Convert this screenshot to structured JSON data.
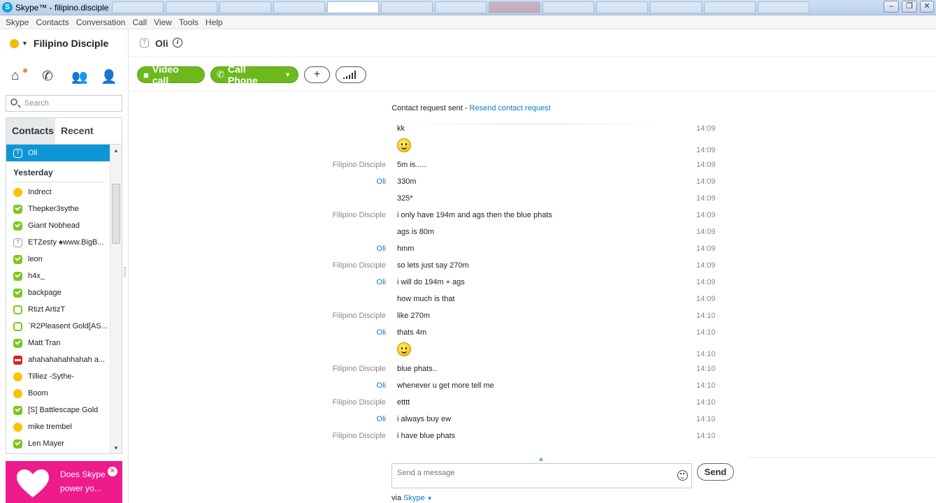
{
  "window": {
    "title": "Skype™ - filipino.disciple",
    "app_icon": "S"
  },
  "menu": [
    "Skype",
    "Contacts",
    "Conversation",
    "Call",
    "View",
    "Tools",
    "Help"
  ],
  "profile": {
    "name": "Filipino Disciple",
    "status": "away"
  },
  "search": {
    "placeholder": "Search"
  },
  "tabs": {
    "contacts": "Contacts",
    "recent": "Recent"
  },
  "contacts": {
    "selected": {
      "name": "Oli",
      "status": "unknown"
    },
    "group_label": "Yesterday",
    "items": [
      {
        "name": "Indrect",
        "status": "away"
      },
      {
        "name": "Thepker3sythe",
        "status": "online"
      },
      {
        "name": "Giant Nobhead",
        "status": "online"
      },
      {
        "name": "ETZesty ♠www.BigB...",
        "status": "unknown"
      },
      {
        "name": "leon",
        "status": "online"
      },
      {
        "name": "h4x_",
        "status": "online"
      },
      {
        "name": "backpage",
        "status": "online"
      },
      {
        "name": "Rtizt ArtizT",
        "status": "offline"
      },
      {
        "name": "`R2Pleasent Gold[AS...",
        "status": "offline"
      },
      {
        "name": "Matt Tran",
        "status": "online"
      },
      {
        "name": "ahahahahahhahah a...",
        "status": "busy"
      },
      {
        "name": "Tilliez -Sythe-",
        "status": "away"
      },
      {
        "name": "Boom",
        "status": "away"
      },
      {
        "name": "[S] Battlescape Gold",
        "status": "online"
      },
      {
        "name": "mike trembel",
        "status": "away"
      },
      {
        "name": "Len Mayer",
        "status": "online"
      }
    ]
  },
  "ad": {
    "text": "Does Skype power yo..."
  },
  "conversation": {
    "contact_name": "Oli",
    "contact_status": "unknown",
    "mood_icon": "i",
    "video_call_label": "Video call",
    "call_phone_label": "Call Phone",
    "add_label": "+",
    "request": {
      "text": "Contact request sent - ",
      "link": "Resend contact request"
    },
    "messages": [
      {
        "sender": "",
        "who": "me",
        "text": "kk",
        "time": "14:09"
      },
      {
        "sender": "",
        "who": "me",
        "text": "",
        "emoji": "smiley",
        "time": "14:09"
      },
      {
        "sender": "Filipino Disciple",
        "who": "me",
        "text": "5m is.....",
        "time": "14:09"
      },
      {
        "sender": "Oli",
        "who": "oli",
        "text": "330m",
        "time": "14:09"
      },
      {
        "sender": "",
        "who": "oli",
        "text": "325*",
        "time": "14:09"
      },
      {
        "sender": "Filipino Disciple",
        "who": "me",
        "text": "i only have 194m and ags then the blue phats",
        "time": "14:09"
      },
      {
        "sender": "",
        "who": "me",
        "text": "ags is 80m",
        "time": "14:09"
      },
      {
        "sender": "Oli",
        "who": "oli",
        "text": "hmm",
        "time": "14:09"
      },
      {
        "sender": "Filipino Disciple",
        "who": "me",
        "text": "so lets just say 270m",
        "time": "14:09"
      },
      {
        "sender": "Oli",
        "who": "oli",
        "text": "i will do 194m + ags",
        "time": "14:09"
      },
      {
        "sender": "",
        "who": "oli",
        "text": "how much is that",
        "time": "14:09"
      },
      {
        "sender": "Filipino Disciple",
        "who": "me",
        "text": "like 270m",
        "time": "14:10"
      },
      {
        "sender": "Oli",
        "who": "oli",
        "text": "thats 4m",
        "time": "14:10"
      },
      {
        "sender": "",
        "who": "oli",
        "text": "",
        "emoji": "smiley",
        "time": "14:10"
      },
      {
        "sender": "Filipino Disciple",
        "who": "me",
        "text": "blue phats..",
        "time": "14:10"
      },
      {
        "sender": "Oli",
        "who": "oli",
        "text": "whenever u get more tell me",
        "time": "14:10"
      },
      {
        "sender": "Filipino Disciple",
        "who": "me",
        "text": "etttt",
        "time": "14:10"
      },
      {
        "sender": "Oli",
        "who": "oli",
        "text": "i always buy ew",
        "time": "14:10"
      },
      {
        "sender": "Filipino Disciple",
        "who": "me",
        "text": "i have blue phats",
        "time": "14:10"
      }
    ]
  },
  "compose": {
    "placeholder": "Send a message",
    "send_label": "Send",
    "via_text": "via ",
    "via_link": "Skype"
  },
  "colors": {
    "accent_blue": "#0c96d5",
    "call_green": "#6cb91d",
    "ad_pink": "#ee1b8d",
    "link_blue": "#0c7cc5"
  }
}
